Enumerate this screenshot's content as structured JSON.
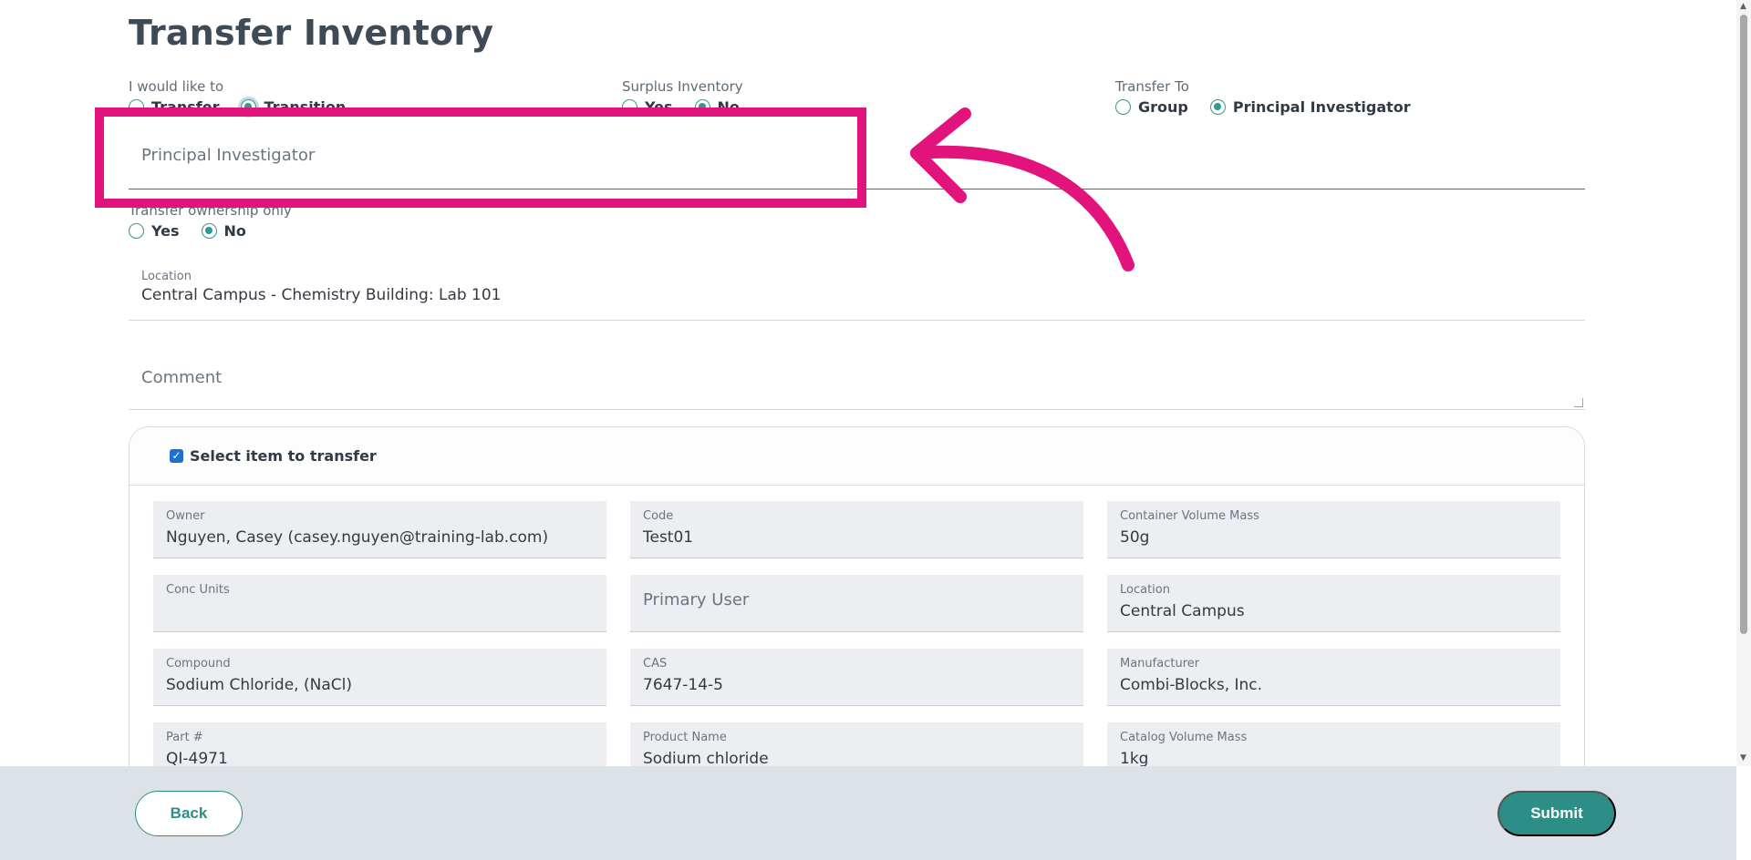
{
  "page": {
    "title": "Transfer Inventory"
  },
  "would_like_to": {
    "label": "I would like to",
    "options": [
      "Transfer",
      "Transition"
    ],
    "selected": "Transition"
  },
  "surplus": {
    "label": "Surplus Inventory",
    "options": [
      "Yes",
      "No"
    ],
    "selected": "No"
  },
  "transfer_to": {
    "label": "Transfer To",
    "options": [
      "Group",
      "Principal Investigator"
    ],
    "selected": "Principal Investigator"
  },
  "pi_field": {
    "placeholder": "Principal Investigator"
  },
  "ownership": {
    "label": "Transfer ownership only",
    "options": [
      "Yes",
      "No"
    ],
    "selected": "No"
  },
  "location": {
    "label": "Location",
    "value": "Central Campus - Chemistry Building: Lab 101"
  },
  "comment": {
    "placeholder": "Comment"
  },
  "item_card": {
    "select_label": "Select item to transfer",
    "checked": true,
    "fields": [
      {
        "label": "Owner",
        "value": "Nguyen, Casey (casey.nguyen@training-lab.com)"
      },
      {
        "label": "Code",
        "value": "Test01"
      },
      {
        "label": "Container Volume Mass",
        "value": "50g"
      },
      {
        "label": "Conc Units",
        "value": ""
      },
      {
        "label": "",
        "value": "",
        "placeholder": "Primary User"
      },
      {
        "label": "Location",
        "value": "Central Campus"
      },
      {
        "label": "Compound",
        "value": "Sodium Chloride, (NaCl)"
      },
      {
        "label": "CAS",
        "value": "7647-14-5"
      },
      {
        "label": "Manufacturer",
        "value": "Combi-Blocks, Inc."
      },
      {
        "label": "Part #",
        "value": "QI-4971"
      },
      {
        "label": "Product Name",
        "value": "Sodium chloride"
      },
      {
        "label": "Catalog Volume Mass",
        "value": "1kg"
      }
    ]
  },
  "footer": {
    "back_label": "Back",
    "submit_label": "Submit"
  },
  "colors": {
    "accent": "#2d8d87",
    "annotation": "#e3137d",
    "footer_bg": "#dde1e8"
  }
}
